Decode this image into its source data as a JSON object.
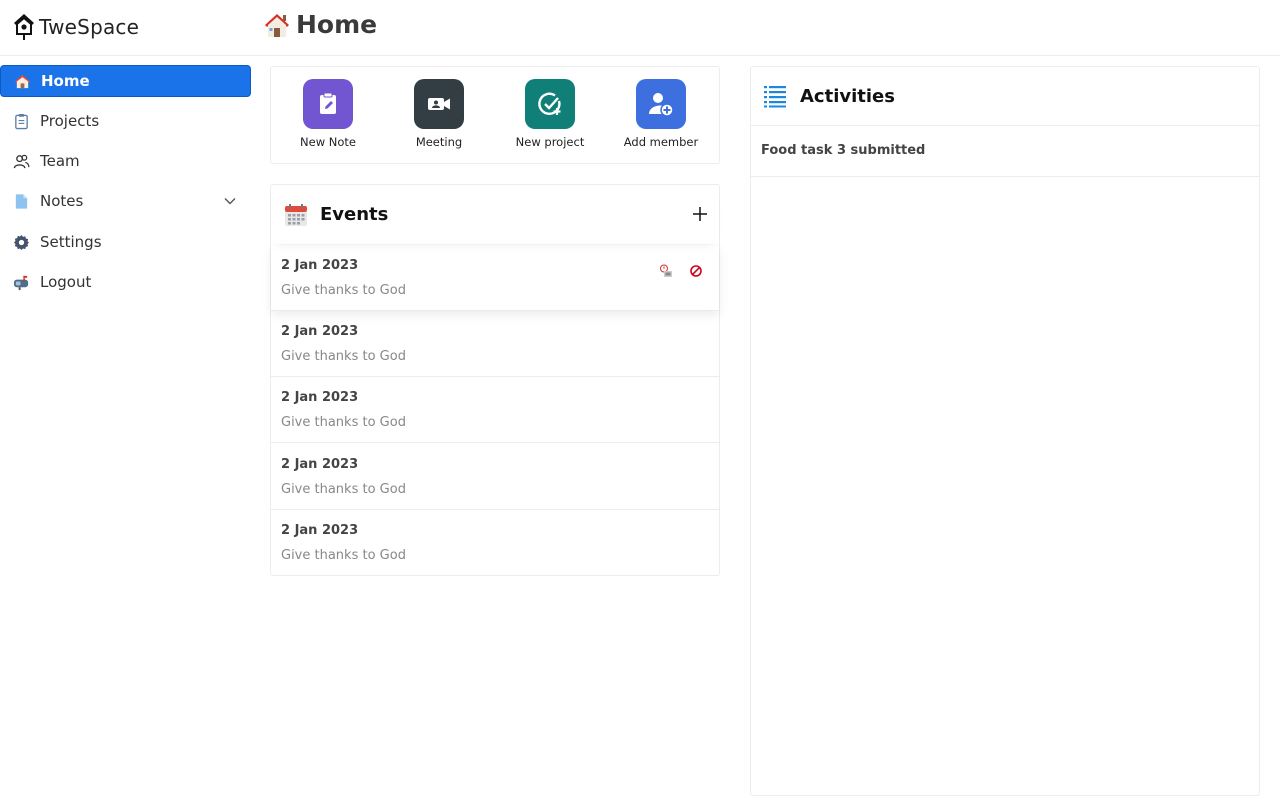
{
  "app": {
    "name": "TweSpace"
  },
  "page": {
    "title": "Home"
  },
  "sidebar": {
    "items": [
      {
        "label": "Home",
        "icon": "house-icon",
        "active": true
      },
      {
        "label": "Projects",
        "icon": "clipboard-icon"
      },
      {
        "label": "Team",
        "icon": "team-icon"
      },
      {
        "label": "Notes",
        "icon": "document-icon",
        "has_submenu": true
      },
      {
        "label": "Settings",
        "icon": "gear-icon"
      },
      {
        "label": "Logout",
        "icon": "mailbox-icon"
      }
    ]
  },
  "quick_actions": [
    {
      "label": "New Note",
      "icon": "edit-clipboard-icon",
      "color": "#7256d1"
    },
    {
      "label": "Meeting",
      "icon": "video-camera-icon",
      "color": "#333e44"
    },
    {
      "label": "New project",
      "icon": "check-add-icon",
      "color": "#0f7f78"
    },
    {
      "label": "Add member",
      "icon": "add-user-icon",
      "color": "#3e6fde"
    }
  ],
  "events": {
    "title": "Events",
    "items": [
      {
        "date": "2 Jan 2023",
        "description": "Give thanks to God"
      },
      {
        "date": "2 Jan 2023",
        "description": "Give thanks to God"
      },
      {
        "date": "2 Jan 2023",
        "description": "Give thanks to God"
      },
      {
        "date": "2 Jan 2023",
        "description": "Give thanks to God"
      },
      {
        "date": "2 Jan 2023",
        "description": "Give thanks to God"
      }
    ]
  },
  "activities": {
    "title": "Activities",
    "items": [
      "Food task 3 submitted"
    ]
  },
  "colors": {
    "accent": "#1a73e8",
    "danger": "#d0021b"
  }
}
